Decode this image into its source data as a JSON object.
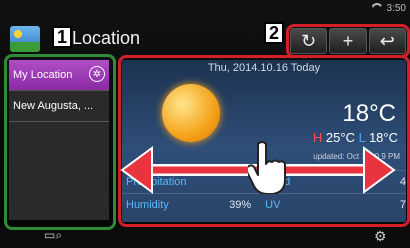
{
  "status": {
    "time": "3:50"
  },
  "header": {
    "title": "Location"
  },
  "callouts": {
    "one": "1",
    "two": "2"
  },
  "buttons": {
    "refresh": "↻",
    "add": "+",
    "back": "↩"
  },
  "locations": [
    {
      "label": "My Location",
      "selected": true
    },
    {
      "label": "New Augusta, ...",
      "selected": false
    }
  ],
  "weather": {
    "date": "Thu, 2014.10.16 Today",
    "temp": "18°C",
    "high_label": "H",
    "high": "25°C",
    "low_label": "L",
    "low": "18°C",
    "updated": "updated: Oct 16, 0  9 PM",
    "rows": [
      {
        "label1": "Precipitation",
        "value1": "",
        "label2": "Wind",
        "value2": "4"
      },
      {
        "label1": "Humidity",
        "value1": "39%",
        "label2": "UV",
        "value2": "7"
      }
    ]
  },
  "colors": {
    "callout1": "#2f8a3a",
    "callout2": "#d21f2a",
    "selected": "#a03fb8"
  },
  "icons": [
    "wifi-icon",
    "weather-app-icon",
    "refresh-icon",
    "add-icon",
    "back-icon",
    "star-icon",
    "sun-icon",
    "hand-pointer-icon",
    "search-map-icon",
    "settings-gear-icon"
  ]
}
